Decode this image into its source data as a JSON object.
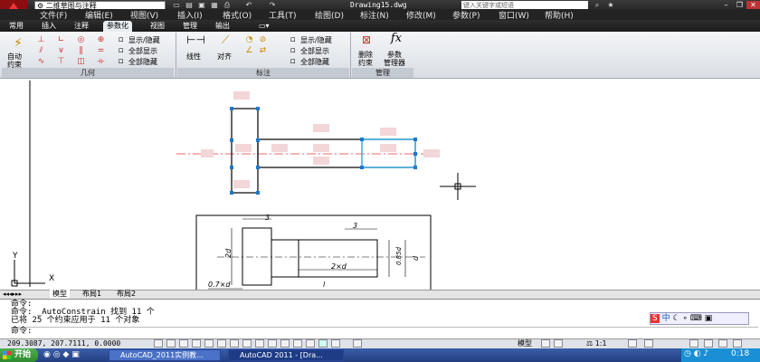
{
  "title_bar": {
    "workspace": "二维草图与注释",
    "document": "Drawing15.dwg",
    "search_placeholder": "键入关键字或短语"
  },
  "menu": [
    "文件(F)",
    "编辑(E)",
    "视图(V)",
    "插入(I)",
    "格式(O)",
    "工具(T)",
    "绘图(D)",
    "标注(N)",
    "修改(M)",
    "参数(P)",
    "窗口(W)",
    "帮助(H)"
  ],
  "ribbon_tabs": [
    "常用",
    "插入",
    "注释",
    "参数化",
    "视图",
    "管理",
    "输出"
  ],
  "ribbon_active_tab": 3,
  "ribbon": {
    "geometry_panel": {
      "auto_constrain_label": "自动\n约束",
      "show_hide": "显示/隐藏",
      "show_all": "全部显示",
      "hide_all": "全部隐藏",
      "title": "几何"
    },
    "dimension_panel": {
      "linear": "线性",
      "aligned": "对齐",
      "show_hide": "显示/隐藏",
      "show_all": "全部显示",
      "hide_all": "全部隐藏",
      "title": "标注"
    },
    "manage_panel": {
      "delete_constraints": "删除\n约束",
      "param_manager": "参数\n管理器",
      "title": "管理"
    }
  },
  "drawing_labels": {
    "dim_3_top": "3",
    "dim_3_right": "3",
    "dim_2d": "2d",
    "dim_085d": "0.85d",
    "dim_d": "d",
    "dim_2xd": "2×d",
    "dim_07xd": "0.7×d",
    "dim_l": "l",
    "ucs_y": "Y",
    "ucs_x": "X"
  },
  "layout_tabs": [
    "模型",
    "布局1",
    "布局2"
  ],
  "command_lines": [
    "命令:",
    "命令:  _AutoConstrain 找到 11 个",
    "已将 25 个约束应用于 11 个对象",
    "命令:"
  ],
  "command_prefix": "命令:",
  "status": {
    "coords": "209.3087, 207.7111, 0.0000",
    "model_label": "模型",
    "scale": "1:1"
  },
  "ime": {
    "logo": "S",
    "text": "中"
  },
  "taskbar": {
    "start": "开始",
    "task1": "AutoCAD_2011实例教...",
    "task2": "AutoCAD 2011 - [Dra...",
    "clock": "0:18"
  }
}
